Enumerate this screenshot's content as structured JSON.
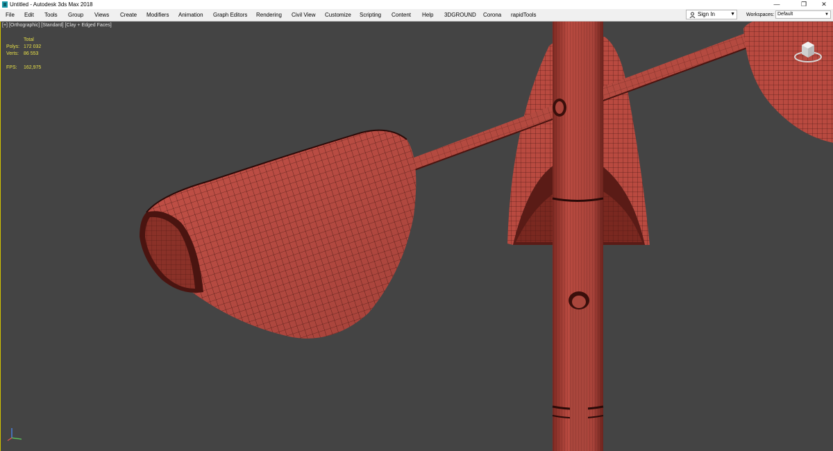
{
  "window": {
    "title": "Untitled - Autodesk 3ds Max 2018",
    "controls": [
      "—",
      "❐",
      "✕"
    ]
  },
  "menu": {
    "items": [
      "File",
      "Edit",
      "Tools",
      "Group",
      "Views",
      "Create",
      "Modifiers",
      "Animation",
      "Graph Editors",
      "Rendering",
      "Civil View",
      "Customize",
      "Scripting",
      "Content",
      "Help",
      "3DGROUND",
      "Corona",
      "rapidTools"
    ]
  },
  "account": {
    "sign_in": "Sign In",
    "workspaces_label": "Workspaces:",
    "workspace_value": "Default"
  },
  "viewport": {
    "labels": [
      "[+]",
      "[Orthographic]",
      "[Standard]",
      "[Clay + Edged Faces]"
    ],
    "stats": {
      "header": "Total",
      "rows": [
        {
          "k": "Polys:",
          "v": "172 032"
        },
        {
          "k": "Verts:",
          "v": "86 553"
        }
      ],
      "fps_label": "FPS:",
      "fps_value": "162,975"
    }
  },
  "colors": {
    "clay": "#b94a40",
    "wire": "#2c0c08",
    "background": "#444444",
    "stats_text": "#e8e047"
  },
  "icons": [
    "app-icon",
    "user-icon",
    "viewcube-icon",
    "axis-tripod-icon"
  ]
}
